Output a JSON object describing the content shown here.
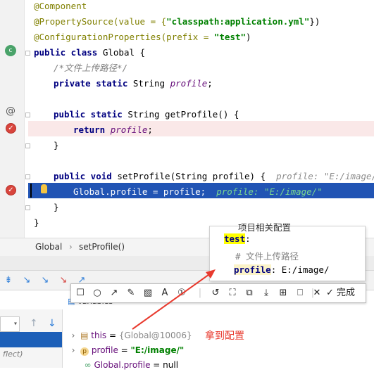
{
  "editor": {
    "lines": {
      "l1": "@Component",
      "l2a": "@PropertySource(value = {",
      "l2b": "\"classpath:application.yml\"",
      "l2c": "})",
      "l3a": "@ConfigurationProperties(prefix = ",
      "l3b": "\"test\"",
      "l3c": ")",
      "l4a": "public class",
      "l4b": " Global {",
      "l5": "/*文件上传路径*/",
      "l6a": "private static",
      "l6b": " String ",
      "l6c": "profile",
      "l6d": ";",
      "l8a": "public static",
      "l8b": " String getProfile() {",
      "l9a": "return",
      "l9b": "profile",
      "l9c": ";",
      "l10": "}",
      "l12a": "public void",
      "l12b": " setProfile(String profile) {",
      "l12hint": "profile: \"E:/image/\"",
      "l13": "Global.profile = profile;",
      "l13hint": "profile: \"E:/image/\"",
      "l14": "}",
      "l15": "}"
    },
    "current_line_color": "#2154b4",
    "breakpoint_color": "#d8453d"
  },
  "breadcrumb": {
    "class": "Global",
    "method": "setProfile()"
  },
  "tooltip": {
    "line0": "项目相关配置",
    "line1": "test",
    "line1_suffix": ":",
    "line2": "# 文件上传路径",
    "line3_key": "profile",
    "line3_sep": ": ",
    "line3_val": "E:/image/"
  },
  "annotation_toolbar": {
    "done_label": "完成"
  },
  "variables": {
    "tab_label": "Variables",
    "rows": [
      {
        "name": "this",
        "eq": " = ",
        "value": "{Global@10006}"
      },
      {
        "name": "profile",
        "eq": " = ",
        "value": "\"E:/image/\""
      },
      {
        "name": "Global.profile",
        "eq": " = ",
        "value": "null"
      }
    ],
    "left_frame_label": "flect)"
  },
  "note": "拿到配置",
  "colors": {
    "annotation_red": "#e83a2e",
    "tooltip_highlight": "#ffff00"
  }
}
